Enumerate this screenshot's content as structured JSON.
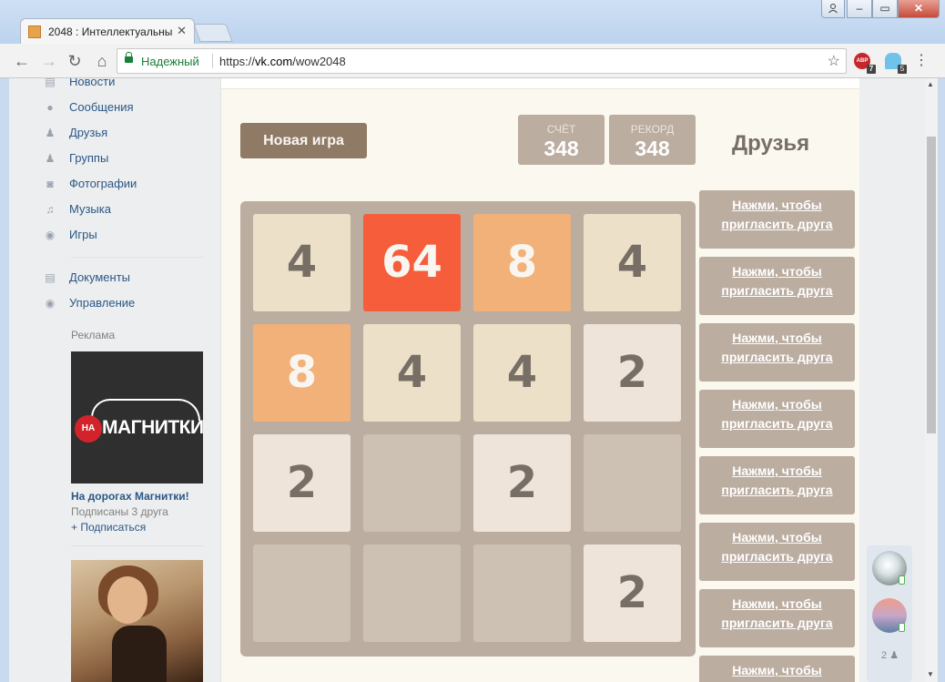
{
  "browser": {
    "tab_title": "2048 : Интеллектуальны",
    "tab_close": "✕",
    "window_buttons": {
      "minimize": "–",
      "maximize": "▭",
      "close": "✕"
    },
    "secure_label": "Надежный",
    "url_scheme": "https://",
    "url_host": "vk.com",
    "url_path": "/wow2048",
    "extensions": [
      {
        "name": "ABP",
        "badge": "7"
      },
      {
        "name": "ghost",
        "badge": "5"
      }
    ],
    "icons": [
      "back-icon",
      "forward-icon",
      "reload-icon",
      "home-icon",
      "lock-icon",
      "star-icon",
      "menu-icon"
    ]
  },
  "sidebar": {
    "items": [
      {
        "label": "Новости",
        "icon": "news-icon"
      },
      {
        "label": "Сообщения",
        "icon": "messages-icon"
      },
      {
        "label": "Друзья",
        "icon": "friends-icon"
      },
      {
        "label": "Группы",
        "icon": "groups-icon"
      },
      {
        "label": "Фотографии",
        "icon": "photos-icon"
      },
      {
        "label": "Музыка",
        "icon": "music-icon"
      },
      {
        "label": "Игры",
        "icon": "games-icon"
      }
    ],
    "items2": [
      {
        "label": "Документы",
        "icon": "documents-icon"
      },
      {
        "label": "Управление",
        "icon": "manage-icon"
      }
    ],
    "ads": {
      "title": "Реклама",
      "ad1_logo_na": "НА",
      "ad1_logo_text": "МАГНИТКИ",
      "ad1_name": "На дорогах Магнитки!",
      "ad1_sub": "Подписаны 3 друга",
      "ad1_follow": "+ Подписаться"
    }
  },
  "game": {
    "new_game": "Новая игра",
    "score_label": "СЧЁТ",
    "score": "348",
    "best_label": "РЕКОРД",
    "best": "348",
    "friends_title": "Друзья",
    "grid": [
      [
        4,
        64,
        8,
        4
      ],
      [
        8,
        4,
        4,
        2
      ],
      [
        2,
        0,
        2,
        0
      ],
      [
        0,
        0,
        0,
        2
      ]
    ],
    "invite_label": "Нажми, чтобы пригласить друга",
    "invite_count": 8
  },
  "online": {
    "count": "2"
  }
}
